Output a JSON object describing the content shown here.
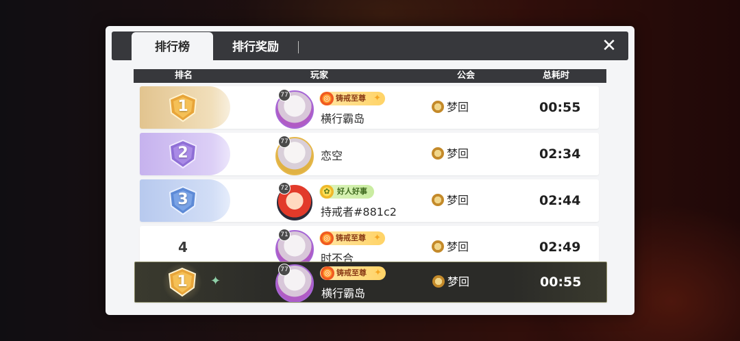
{
  "tabs": [
    "排行榜",
    "排行奖励"
  ],
  "close_symbol": "✕",
  "columns": {
    "rank": "排名",
    "player": "玩家",
    "guild": "公会",
    "time": "总耗时"
  },
  "rows": [
    {
      "rank": "1",
      "level": "77",
      "title": "铸戒至尊",
      "name": "横行霸岛",
      "guild": "梦回",
      "time": "00:55"
    },
    {
      "rank": "2",
      "level": "77",
      "title": "",
      "name": "恋空",
      "guild": "梦回",
      "time": "02:34"
    },
    {
      "rank": "3",
      "level": "72",
      "title": "好人好事",
      "name": "持戒者#881c2",
      "guild": "梦回",
      "time": "02:44"
    },
    {
      "rank": "4",
      "level": "71",
      "title": "铸戒至尊",
      "name": "时不合",
      "guild": "梦回",
      "time": "02:49"
    }
  ],
  "me": {
    "rank": "1",
    "level": "77",
    "title": "铸戒至尊",
    "name": "横行霸岛",
    "guild": "梦回",
    "time": "00:55"
  },
  "colors": {
    "gold": "#e2c48f",
    "silver_purple": "#c6b2ee",
    "bronze_blue": "#b7c9ee",
    "header": "#37383c"
  }
}
